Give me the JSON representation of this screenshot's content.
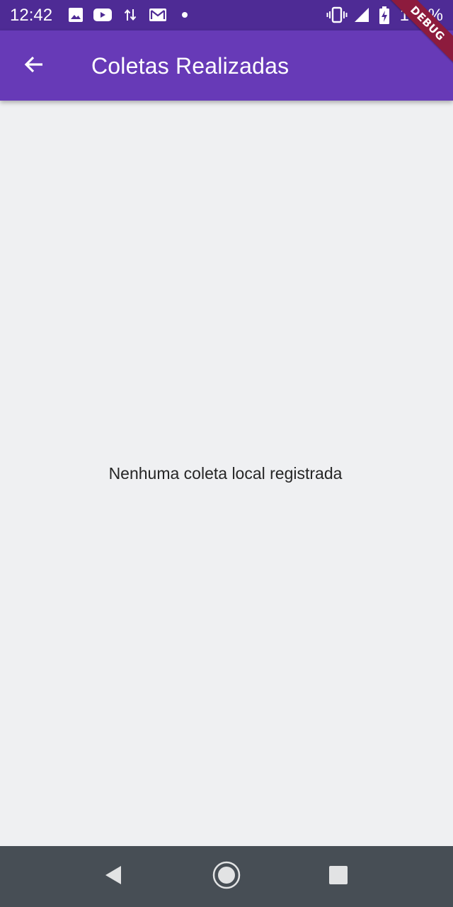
{
  "status_bar": {
    "time": "12:42",
    "battery_percent": "100%",
    "icons": [
      "image-icon",
      "youtube-icon",
      "data-transfer-icon",
      "gmail-icon",
      "notification-dot-icon",
      "vibrate-icon",
      "signal-icon",
      "battery-charging-icon"
    ]
  },
  "app_bar": {
    "title": "Coletas Realizadas",
    "back_icon": "arrow-back-icon"
  },
  "debug_banner": {
    "label": "DEBUG"
  },
  "content": {
    "empty_message": "Nenhuma coleta local registrada"
  },
  "nav_bar": {
    "icons": [
      "back-triangle-icon",
      "home-circle-icon",
      "recents-square-icon"
    ]
  },
  "colors": {
    "status_bar": "#4e2b95",
    "app_bar": "#673ab7",
    "background": "#eff0f2",
    "nav_bar": "#474e55",
    "debug_banner": "#8d1b3d"
  }
}
